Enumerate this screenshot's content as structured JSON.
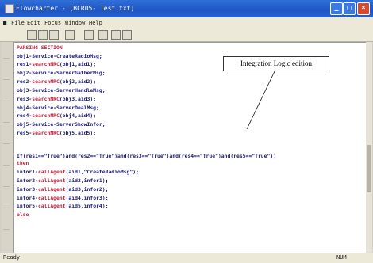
{
  "window": {
    "title": "Flowcharter - [BCR05- Test.txt]",
    "min_glyph": "_",
    "max_glyph": "□",
    "close_glyph": "×"
  },
  "menu": {
    "items": [
      "File",
      "Edit",
      "Focus",
      "Window",
      "Help"
    ]
  },
  "editor": {
    "lines": [
      [
        {
          "t": "PARSING SECTION",
          "k": true
        }
      ],
      [
        {
          "t": "obj1-Service-CreateRadioMsg;",
          "k": false
        }
      ],
      [
        {
          "t": "res1-",
          "k": false
        },
        {
          "t": "searchMRC",
          "k": true
        },
        {
          "t": "(obj1,aid1);",
          "k": false
        }
      ],
      [
        {
          "t": "obj2-Service-ServerGatherMsg;",
          "k": false
        }
      ],
      [
        {
          "t": "res2-",
          "k": false
        },
        {
          "t": "searchMRC",
          "k": true
        },
        {
          "t": "(obj2,aid2);",
          "k": false
        }
      ],
      [
        {
          "t": "obj3-Service-ServerHandleMsg;",
          "k": false
        }
      ],
      [
        {
          "t": "res3-",
          "k": false
        },
        {
          "t": "searchMRC",
          "k": true
        },
        {
          "t": "(obj3,aid3);",
          "k": false
        }
      ],
      [
        {
          "t": "obj4-Service-ServerDealMsg;",
          "k": false
        }
      ],
      [
        {
          "t": "res4-",
          "k": false
        },
        {
          "t": "searchMRC",
          "k": true
        },
        {
          "t": "(obj4,aid4);",
          "k": false
        }
      ],
      [
        {
          "t": "obj5-Service-ServerShowInfor;",
          "k": false
        }
      ],
      [
        {
          "t": "res5-",
          "k": false
        },
        {
          "t": "searchMRC",
          "k": true
        },
        {
          "t": "(obj5,aid5);",
          "k": false
        }
      ],
      [
        {
          "t": "",
          "k": false
        }
      ],
      [
        {
          "t": "If(res1==\"True\")and(res2==\"True\")and(res3==\"True\")and(res4==\"True\")and(res5==\"True\"))",
          "k": false
        }
      ],
      [
        {
          "t": "then",
          "k": true
        }
      ],
      [
        {
          "t": "infor1-",
          "k": false
        },
        {
          "t": "callAgent",
          "k": true
        },
        {
          "t": "(aid1,\"CreateRadioMsg\");",
          "k": false
        }
      ],
      [
        {
          "t": "infor2-",
          "k": false
        },
        {
          "t": "callAgent",
          "k": true
        },
        {
          "t": "(aid2,infor1);",
          "k": false
        }
      ],
      [
        {
          "t": "infor3-",
          "k": false
        },
        {
          "t": "callAgent",
          "k": true
        },
        {
          "t": "(aid3,infor2);",
          "k": false
        }
      ],
      [
        {
          "t": "infor4-",
          "k": false
        },
        {
          "t": "callAgent",
          "k": true
        },
        {
          "t": "(aid4,infor3);",
          "k": false
        }
      ],
      [
        {
          "t": "infor5-",
          "k": false
        },
        {
          "t": "callAgent",
          "k": true
        },
        {
          "t": "(aid5,infor4);",
          "k": false
        }
      ],
      [
        {
          "t": "else",
          "k": true
        }
      ]
    ]
  },
  "annotation": {
    "label": "Integration Logic edition"
  },
  "status": {
    "left": "Ready",
    "right": "NUM"
  },
  "colors": {
    "code_text": "#1a1a7a",
    "keyword": "#c0203a",
    "titlebar": "#1f54c4"
  }
}
